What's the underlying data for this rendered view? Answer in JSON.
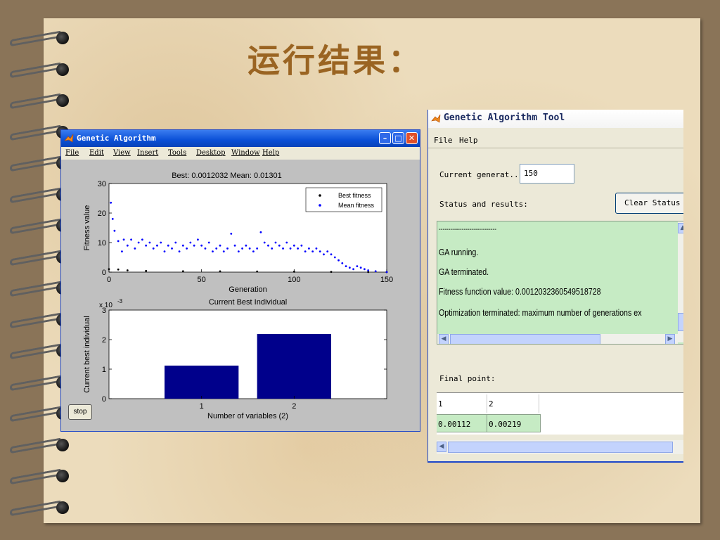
{
  "slide": {
    "title": "运行结果："
  },
  "figure_window": {
    "title": "Genetic Algorithm",
    "menu": [
      "File",
      "Edit",
      "View",
      "Insert",
      "Tools",
      "Desktop",
      "Window",
      "Help"
    ],
    "stop_label": "stop",
    "controls": [
      "minimize",
      "maximize",
      "close"
    ]
  },
  "chart_data": [
    {
      "type": "scatter",
      "title": "Best: 0.0012032 Mean: 0.01301",
      "xlabel": "Generation",
      "ylabel": "Fitness value",
      "xlim": [
        0,
        150
      ],
      "ylim": [
        0,
        30
      ],
      "xticks": [
        0,
        50,
        100,
        150
      ],
      "yticks": [
        0,
        10,
        20,
        30
      ],
      "legend_position": "top-right",
      "series": [
        {
          "name": "Best fitness",
          "color": "#000000",
          "marker": "dot",
          "points": [
            [
              0,
              1
            ],
            [
              5,
              0.9
            ],
            [
              10,
              0.6
            ],
            [
              20,
              0.4
            ],
            [
              40,
              0.3
            ],
            [
              60,
              0.25
            ],
            [
              80,
              0.2
            ],
            [
              100,
              0.15
            ],
            [
              120,
              0.08
            ],
            [
              140,
              0.02
            ],
            [
              150,
              0.0012
            ]
          ]
        },
        {
          "name": "Mean fitness",
          "color": "#0000ff",
          "marker": "dot",
          "points": [
            [
              1,
              23.5
            ],
            [
              2,
              18
            ],
            [
              3,
              14
            ],
            [
              5,
              10.5
            ],
            [
              7,
              7
            ],
            [
              8,
              11
            ],
            [
              10,
              9
            ],
            [
              12,
              11
            ],
            [
              14,
              8
            ],
            [
              16,
              10
            ],
            [
              18,
              11
            ],
            [
              20,
              9
            ],
            [
              22,
              10
            ],
            [
              24,
              8
            ],
            [
              26,
              9
            ],
            [
              28,
              10
            ],
            [
              30,
              7
            ],
            [
              32,
              9
            ],
            [
              34,
              8
            ],
            [
              36,
              10
            ],
            [
              38,
              7
            ],
            [
              40,
              9
            ],
            [
              42,
              8
            ],
            [
              44,
              10
            ],
            [
              46,
              9
            ],
            [
              48,
              11
            ],
            [
              50,
              9
            ],
            [
              52,
              8
            ],
            [
              54,
              10
            ],
            [
              56,
              7
            ],
            [
              58,
              8
            ],
            [
              60,
              9
            ],
            [
              62,
              7
            ],
            [
              64,
              8
            ],
            [
              66,
              13
            ],
            [
              68,
              9
            ],
            [
              70,
              7
            ],
            [
              72,
              8
            ],
            [
              74,
              9
            ],
            [
              76,
              8
            ],
            [
              78,
              7
            ],
            [
              80,
              8
            ],
            [
              82,
              13.5
            ],
            [
              84,
              10
            ],
            [
              86,
              9
            ],
            [
              88,
              8
            ],
            [
              90,
              10
            ],
            [
              92,
              9
            ],
            [
              94,
              8
            ],
            [
              96,
              10
            ],
            [
              98,
              8
            ],
            [
              100,
              9
            ],
            [
              102,
              8
            ],
            [
              104,
              9
            ],
            [
              106,
              7
            ],
            [
              108,
              8
            ],
            [
              110,
              7
            ],
            [
              112,
              8
            ],
            [
              114,
              7
            ],
            [
              116,
              6
            ],
            [
              118,
              7
            ],
            [
              120,
              6
            ],
            [
              122,
              5
            ],
            [
              124,
              4
            ],
            [
              126,
              3
            ],
            [
              128,
              2
            ],
            [
              130,
              1.5
            ],
            [
              132,
              1
            ],
            [
              134,
              2
            ],
            [
              136,
              1.5
            ],
            [
              138,
              1
            ],
            [
              140,
              0.6
            ],
            [
              144,
              0.3
            ],
            [
              150,
              0.013
            ]
          ]
        }
      ]
    },
    {
      "type": "bar",
      "title": "Current Best Individual",
      "xlabel": "Number of variables (2)",
      "ylabel": "Current best individual",
      "y_exponent_label": "x 10",
      "y_exponent": "-3",
      "categories": [
        "1",
        "2"
      ],
      "values": [
        0.00112,
        0.00219
      ],
      "ylim": [
        0,
        0.003
      ],
      "yticks": [
        0,
        1,
        2,
        3
      ],
      "bar_color": "#00008b"
    }
  ],
  "ga_tool": {
    "title": "Genetic Algorithm Tool",
    "menu": [
      "File",
      "Help"
    ],
    "current_generation_label": "Current generat...",
    "current_generation_value": "150",
    "status_label": "Status and results:",
    "clear_status_label": "Clear Status",
    "status_lines": [
      "------------------------------",
      "GA running.",
      "GA terminated.",
      "Fitness function value: 0.0012032360549518728",
      "Optimization terminated: maximum number of generations ex"
    ],
    "final_point_label": "Final point:",
    "final_point_headers": [
      "1",
      "2"
    ],
    "final_point_values": [
      "0.00112",
      "0.00219"
    ]
  }
}
